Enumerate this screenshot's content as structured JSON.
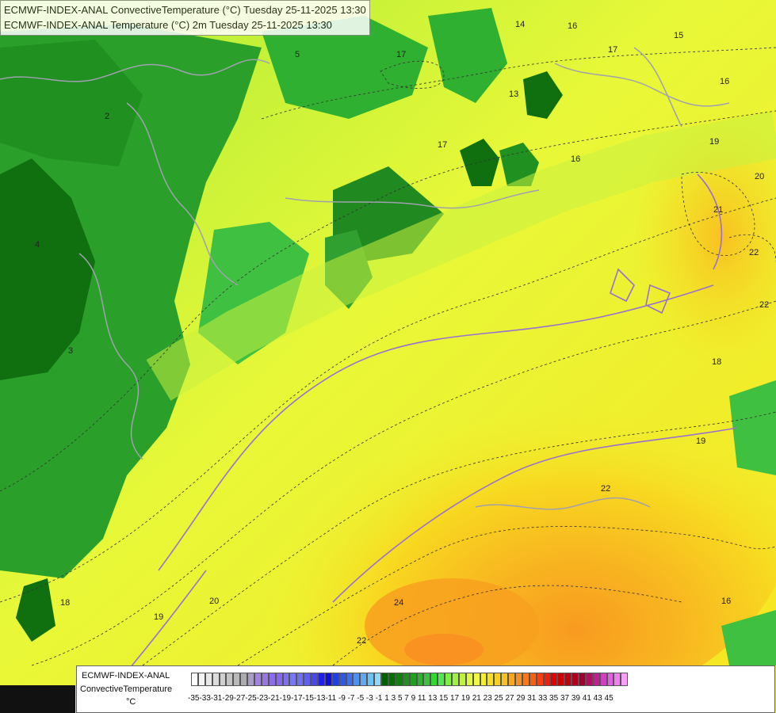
{
  "header": {
    "line1": "ECMWF-INDEX-ANAL ConvectiveTemperature (°C) Tuesday 25-11-2025 13:30",
    "line2": "ECMWF-INDEX-ANAL Temperature (°C) 2m Tuesday 25-11-2025 13:30"
  },
  "legend": {
    "model": "ECMWF-INDEX-ANAL",
    "parameter": "ConvectiveTemperature",
    "unit": "°C",
    "ticks": "-35-33-31-29-27-25-23-21-19-17-15-13-11 -9  -7  -5  -3  -1   1   3   5   7   9  11  13  15  17  19  21  23  25  27  29  31  33  35  37  39  41  43  45",
    "colors": [
      "#ffffff",
      "#f4f4f4",
      "#e8e8e8",
      "#dcdcdc",
      "#d0d0d0",
      "#c4c4c4",
      "#b8b8b8",
      "#acacac",
      "#a89cc8",
      "#a084d8",
      "#9878e0",
      "#8c6ce8",
      "#8868f0",
      "#8070f0",
      "#7878f0",
      "#7070f0",
      "#6060f0",
      "#4848f0",
      "#2020e8",
      "#1010d8",
      "#2040e0",
      "#3058e8",
      "#4070f0",
      "#5090f0",
      "#60a8f0",
      "#70c0f0",
      "#90d8f8",
      "#006000",
      "#007000",
      "#108010",
      "#209020",
      "#20a020",
      "#30b030",
      "#40c040",
      "#30d830",
      "#50e850",
      "#80f040",
      "#a0f040",
      "#c0f040",
      "#e0f840",
      "#f0f840",
      "#f8f020",
      "#f8e020",
      "#f8d020",
      "#f8c020",
      "#f8a820",
      "#f89020",
      "#f87820",
      "#f86010",
      "#f84010",
      "#f02010",
      "#e00000",
      "#d00000",
      "#c00010",
      "#b00020",
      "#a00030",
      "#b01060",
      "#c02090",
      "#d040c0",
      "#e060e0",
      "#f080f0",
      "#f8a0f8"
    ]
  },
  "contour_labels": [
    "14",
    "16",
    "17",
    "15",
    "16",
    "13",
    "17",
    "16",
    "19",
    "20",
    "21",
    "22",
    "22",
    "18",
    "19",
    "22",
    "16",
    "17",
    "18",
    "19",
    "20",
    "24",
    "22",
    "4",
    "5",
    "3",
    "2"
  ]
}
